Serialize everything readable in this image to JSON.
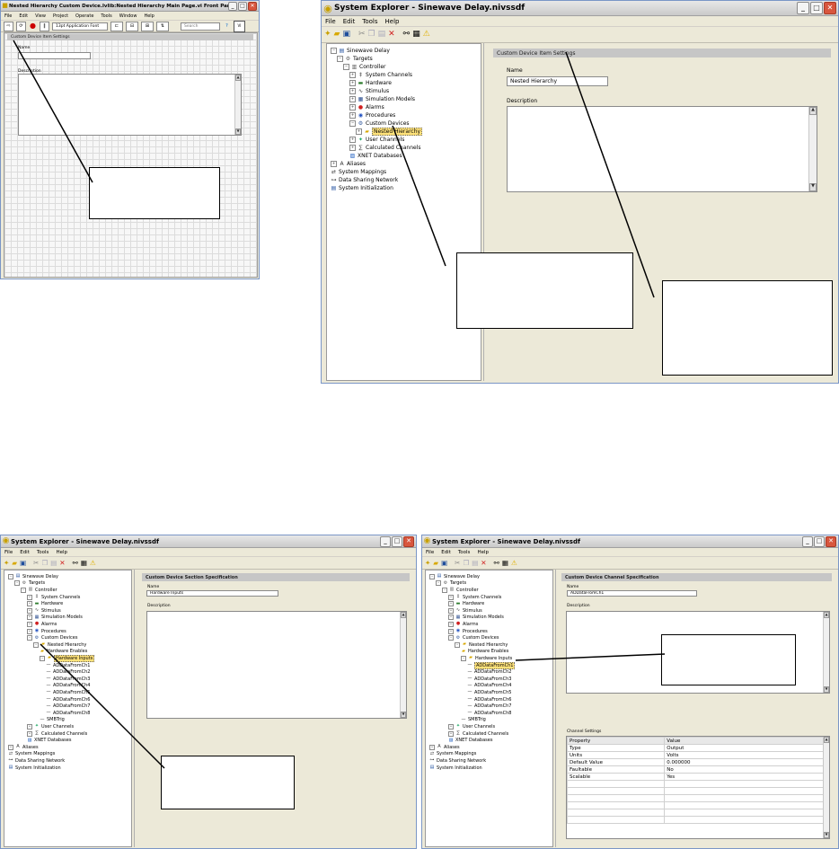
{
  "win1": {
    "title": "Nested Hierarchy Custom Device.lvlib:Nested Hierarchy Main Page.vi Front Panel on Nested Hi...",
    "menu": [
      "File",
      "Edit",
      "View",
      "Project",
      "Operate",
      "Tools",
      "Window",
      "Help"
    ],
    "font_label": "13pt Application Font",
    "search_placeholder": "Search",
    "section_header": "Custom Device Item Settings",
    "name_label": "Name",
    "name_value": "",
    "description_label": "Description"
  },
  "win2": {
    "title": "System Explorer - Sinewave Delay.nivssdf",
    "menu": [
      "File",
      "Edit",
      "Tools",
      "Help"
    ],
    "tree": [
      {
        "label": "Sinewave Delay"
      },
      {
        "label": "Targets"
      },
      {
        "label": "Controller"
      },
      {
        "label": "System Channels"
      },
      {
        "label": "Hardware"
      },
      {
        "label": "Stimulus"
      },
      {
        "label": "Simulation Models"
      },
      {
        "label": "Alarms"
      },
      {
        "label": "Procedures"
      },
      {
        "label": "Custom Devices"
      },
      {
        "label": "Nested Hierarchy"
      },
      {
        "label": "User Channels"
      },
      {
        "label": "Calculated Channels"
      },
      {
        "label": "XNET Databases"
      },
      {
        "label": "Aliases"
      },
      {
        "label": "System Mappings"
      },
      {
        "label": "Data Sharing Network"
      },
      {
        "label": "System Initialization"
      }
    ],
    "section_header": "Custom Device Item Settings",
    "name_label": "Name",
    "name_value": "Nested Hierarchy",
    "description_label": "Description"
  },
  "win3": {
    "title": "System Explorer - Sinewave Delay.nivssdf",
    "menu": [
      "File",
      "Edit",
      "Tools",
      "Help"
    ],
    "tree": [
      {
        "label": "Sinewave Delay"
      },
      {
        "label": "Targets"
      },
      {
        "label": "Controller"
      },
      {
        "label": "System Channels"
      },
      {
        "label": "Hardware"
      },
      {
        "label": "Stimulus"
      },
      {
        "label": "Simulation Models"
      },
      {
        "label": "Alarms"
      },
      {
        "label": "Procedures"
      },
      {
        "label": "Custom Devices"
      },
      {
        "label": "Nested Hierarchy"
      },
      {
        "label": "Hardware Enables"
      },
      {
        "label": "Hardware Inputs"
      },
      {
        "label": "ADDataFromCh1"
      },
      {
        "label": "ADDataFromCh2"
      },
      {
        "label": "ADDataFromCh3"
      },
      {
        "label": "ADDataFromCh4"
      },
      {
        "label": "ADDataFromCh5"
      },
      {
        "label": "ADDataFromCh6"
      },
      {
        "label": "ADDataFromCh7"
      },
      {
        "label": "ADDataFromCh8"
      },
      {
        "label": "SMBTrig"
      },
      {
        "label": "User Channels"
      },
      {
        "label": "Calculated Channels"
      },
      {
        "label": "XNET Databases"
      },
      {
        "label": "Aliases"
      },
      {
        "label": "System Mappings"
      },
      {
        "label": "Data Sharing Network"
      },
      {
        "label": "System Initialization"
      }
    ],
    "section_header": "Custom Device Section Specification",
    "name_label": "Name",
    "name_value": "Hardware Inputs",
    "description_label": "Description"
  },
  "win4": {
    "title": "System Explorer - Sinewave Delay.nivssdf",
    "menu": [
      "File",
      "Edit",
      "Tools",
      "Help"
    ],
    "tree": [
      {
        "label": "Sinewave Delay"
      },
      {
        "label": "Targets"
      },
      {
        "label": "Controller"
      },
      {
        "label": "System Channels"
      },
      {
        "label": "Hardware"
      },
      {
        "label": "Stimulus"
      },
      {
        "label": "Simulation Models"
      },
      {
        "label": "Alarms"
      },
      {
        "label": "Procedures"
      },
      {
        "label": "Custom Devices"
      },
      {
        "label": "Nested Hierarchy"
      },
      {
        "label": "Hardware Enables"
      },
      {
        "label": "Hardware Inputs"
      },
      {
        "label": "ADDataFromCh1"
      },
      {
        "label": "ADDataFromCh2"
      },
      {
        "label": "ADDataFromCh3"
      },
      {
        "label": "ADDataFromCh4"
      },
      {
        "label": "ADDataFromCh5"
      },
      {
        "label": "ADDataFromCh6"
      },
      {
        "label": "ADDataFromCh7"
      },
      {
        "label": "ADDataFromCh8"
      },
      {
        "label": "SMBTrig"
      },
      {
        "label": "User Channels"
      },
      {
        "label": "Calculated Channels"
      },
      {
        "label": "XNET Databases"
      },
      {
        "label": "Aliases"
      },
      {
        "label": "System Mappings"
      },
      {
        "label": "Data Sharing Network"
      },
      {
        "label": "System Initialization"
      }
    ],
    "section_header": "Custom Device Channel Specification",
    "name_label": "Name",
    "name_value": "ADDataFromCh1",
    "description_label": "Description",
    "channel_settings_label": "Channel Settings",
    "table_headers": [
      "Property",
      "Value"
    ],
    "table_rows": [
      [
        "Type",
        "Output"
      ],
      [
        "Units",
        "Volts"
      ],
      [
        "Default Value",
        "0.000000"
      ],
      [
        "Faultable",
        "No"
      ],
      [
        "Scalable",
        "Yes"
      ]
    ]
  },
  "colors": {
    "window_bg": "#ece9d8",
    "section_header_bg": "#c6c6c6",
    "selection": "#ffe27a",
    "title_gradient_top": "#e8e8e8"
  }
}
